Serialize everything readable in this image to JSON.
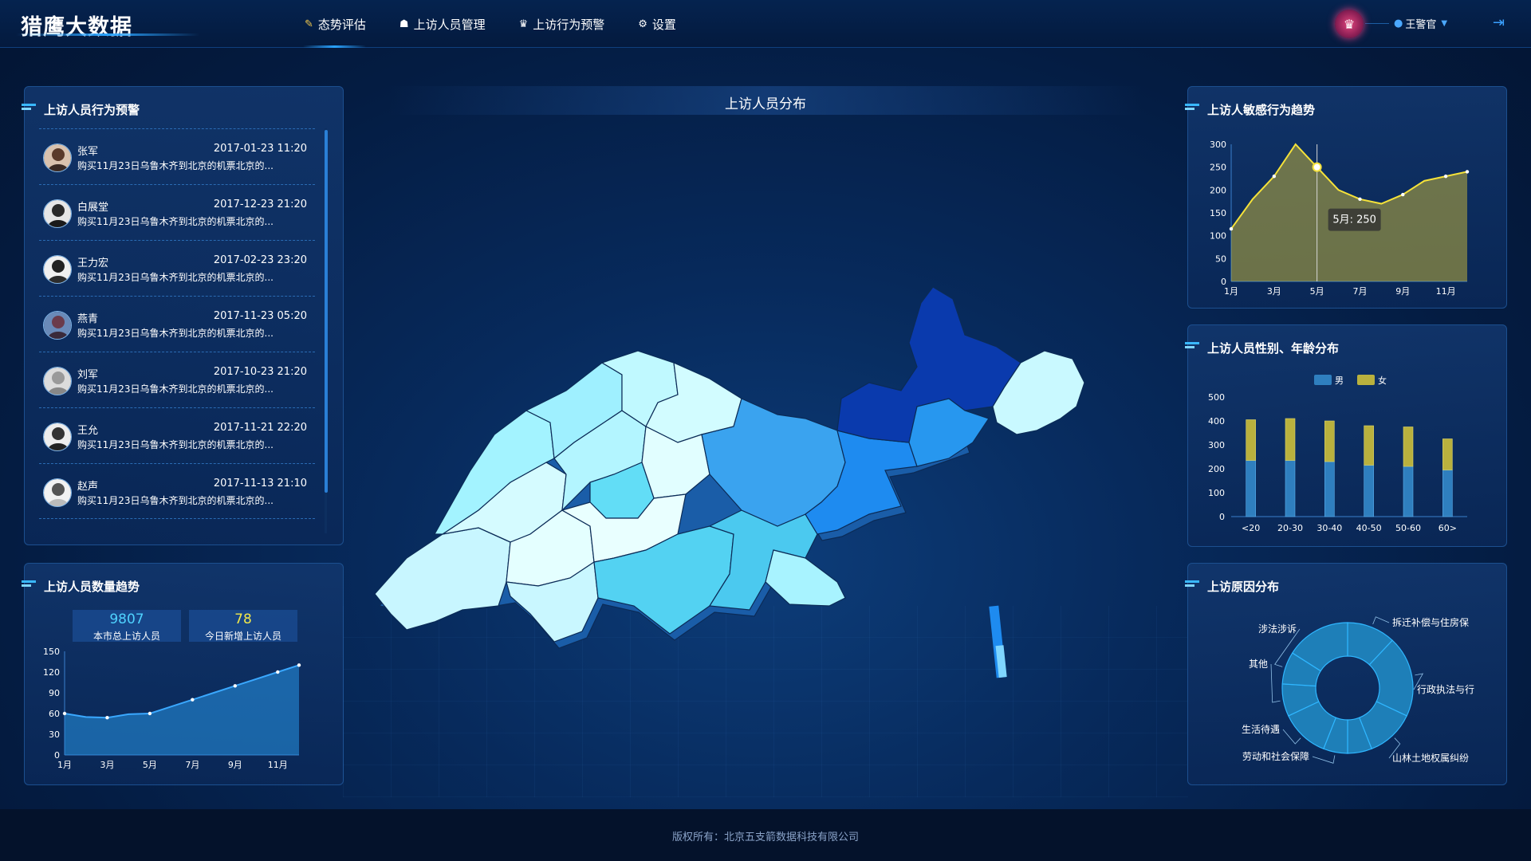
{
  "header": {
    "logo": "猎鹰大数据",
    "nav": [
      {
        "label": "态势评估",
        "icon": "edit-icon",
        "active": true
      },
      {
        "label": "上访人员管理",
        "icon": "user-group-icon",
        "active": false
      },
      {
        "label": "上访行为预警",
        "icon": "alarm-icon",
        "active": false
      },
      {
        "label": "设置",
        "icon": "gear-icon",
        "active": false
      }
    ],
    "user_name": "王警官",
    "badge_icon": "police-badge-icon",
    "logout_icon": "logout-icon"
  },
  "alerts": {
    "title": "上访人员行为预警",
    "items": [
      {
        "name": "张军",
        "time": "2017-01-23 11:20",
        "desc": "购买11月23日乌鲁木齐到北京的机票北京的..."
      },
      {
        "name": "白展堂",
        "time": "2017-12-23 21:20",
        "desc": "购买11月23日乌鲁木齐到北京的机票北京的..."
      },
      {
        "name": "王力宏",
        "time": "2017-02-23 23:20",
        "desc": "购买11月23日乌鲁木齐到北京的机票北京的..."
      },
      {
        "name": "燕青",
        "time": "2017-11-23 05:20",
        "desc": "购买11月23日乌鲁木齐到北京的机票北京的..."
      },
      {
        "name": "刘军",
        "time": "2017-10-23 21:20",
        "desc": "购买11月23日乌鲁木齐到北京的机票北京的..."
      },
      {
        "name": "王允",
        "time": "2017-11-21 22:20",
        "desc": "购买11月23日乌鲁木齐到北京的机票北京的..."
      },
      {
        "name": "赵声",
        "time": "2017-11-13 21:10",
        "desc": "购买11月23日乌鲁木齐到北京的机票北京的..."
      }
    ]
  },
  "trend": {
    "title": "上访人员数量趋势",
    "total": "9807",
    "total_label": "本市总上访人员",
    "today": "78",
    "today_label": "今日新增上访人员"
  },
  "map": {
    "title": "上访人员分布"
  },
  "footer": {
    "text": "版权所有：北京五支箭数据科技有限公司"
  },
  "colors": {
    "accent": "#39b8ff",
    "total": "#4fd2ff",
    "today": "#f2e84b",
    "line_yellow": "#f5e23a",
    "male": "#2f7fbf",
    "female": "#b9b13e"
  },
  "chart_data": [
    {
      "id": "count-trend",
      "type": "area",
      "title": "上访人员数量趋势",
      "x": [
        "1月",
        "2月",
        "3月",
        "4月",
        "5月",
        "6月",
        "7月",
        "8月",
        "9月",
        "10月",
        "11月",
        "12月"
      ],
      "x_ticks": [
        "1月",
        "3月",
        "5月",
        "7月",
        "9月",
        "11月"
      ],
      "values": [
        60,
        55,
        54,
        59,
        60,
        70,
        80,
        90,
        100,
        110,
        120,
        130
      ],
      "ylim": [
        0,
        150
      ],
      "y_ticks": [
        0,
        30,
        60,
        90,
        120,
        150
      ]
    },
    {
      "id": "sensitive-trend",
      "type": "area",
      "title": "上访人敏感行为趋势",
      "x": [
        "1月",
        "2月",
        "3月",
        "4月",
        "5月",
        "6月",
        "7月",
        "8月",
        "9月",
        "10月",
        "11月",
        "12月"
      ],
      "x_ticks": [
        "1月",
        "3月",
        "5月",
        "7月",
        "9月",
        "11月"
      ],
      "values": [
        115,
        180,
        230,
        300,
        250,
        200,
        180,
        170,
        190,
        220,
        230,
        240
      ],
      "ylim": [
        0,
        300
      ],
      "y_ticks": [
        0,
        50,
        100,
        150,
        200,
        250,
        300
      ],
      "tooltip": "5月: 250",
      "tooltip_index": 4
    },
    {
      "id": "gender-age",
      "type": "bar",
      "title": "上访人员性别、年龄分布",
      "categories": [
        "<20",
        "20-30",
        "30-40",
        "40-50",
        "50-60",
        "60>"
      ],
      "series": [
        {
          "name": "男",
          "values": [
            235,
            235,
            230,
            215,
            210,
            195
          ]
        },
        {
          "name": "女",
          "values": [
            170,
            175,
            170,
            165,
            165,
            130
          ]
        }
      ],
      "stacked": true,
      "ylim": [
        0,
        500
      ],
      "y_ticks": [
        0,
        100,
        200,
        300,
        400,
        500
      ]
    },
    {
      "id": "reason-pie",
      "type": "pie",
      "title": "上访原因分布",
      "donut": true,
      "slices": [
        {
          "name": "拆迁补偿与住房保障",
          "value": 12,
          "label": "拆迁补偿与住房保"
        },
        {
          "name": "行政执法与行",
          "value": 20
        },
        {
          "name": "山林土地权属纠纷",
          "value": 12
        },
        {
          "name": "",
          "value": 6
        },
        {
          "name": "劳动和社会保障",
          "value": 6
        },
        {
          "name": "生活待遇",
          "value": 12
        },
        {
          "name": "其他",
          "value": 8
        },
        {
          "name": "涉法涉诉",
          "value": 8
        },
        {
          "name": "",
          "value": 16
        }
      ]
    }
  ]
}
